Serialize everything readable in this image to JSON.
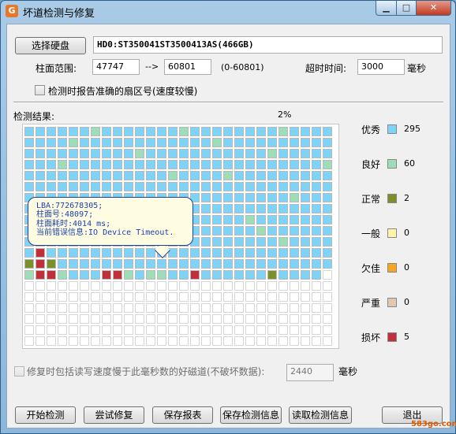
{
  "window": {
    "title": "坏道检测与修复",
    "app_icon_glyph": "G",
    "min_glyph": "▁",
    "max_glyph": "□",
    "close_glyph": "✕"
  },
  "disk": {
    "select_button": "选择硬盘",
    "disk_name": "HD0:ST350041ST3500413AS(466GB)"
  },
  "range": {
    "label": "柱面范围:",
    "start": "47747",
    "arrow": "-->",
    "end": "60801",
    "bounds": "(0-60801)"
  },
  "timeout": {
    "label": "超时时间:",
    "value": "3000",
    "unit": "毫秒"
  },
  "report_sector_checkbox": {
    "label": "检测时报告准确的扇区号(速度较慢)",
    "checked": false
  },
  "result": {
    "label": "检测结果:",
    "progress": "2%"
  },
  "tooltip": {
    "lba": "LBA:772678305;",
    "cylinder": "柱面号:48097;",
    "time": "柱面耗时:4014 ms;",
    "error": "当前错误信息:IO Device Timeout."
  },
  "grid": {
    "columns": 28,
    "rows": 20,
    "cell_states": [
      "AAAAAAGAAAAAAAGAAAAAAAAGAAAA",
      "AAAAGAAAAAAAAAAAAGAAAAAAAAAA",
      "AAAAAAAAAAGAAAAAAAAAAAGAAAAA",
      "AAAGAAAAAAAAAAAAAAAAAAAAAAAG",
      "AAAAAAAAAAAAAGAAAAGAAAAAAAAA",
      "AAAAAAAAAAAAAAAAAAAAAAAAAAAA",
      "AAAAAAAAAAAAAAAAAAAAAAAAGAAA",
      "AAAAAAAAAAAAAAAAAAAAAAAAAAAA",
      "AAAAAAAAAAAAAAAAAAAAGAAAAAAA",
      "AAAAAAAAAAAAAAAAAAAAAGAAAAAA",
      "AAAAAAAAAAAAAAAAAAAAAAAGAAAA",
      "ABAAAAAAAAAAAAAAAAAAAAAAAAAA",
      "ZBNAAAAAAAAAAAAAAAAAAAAAAAAA",
      "GBBGAAABBGAGGAABAAAAAANAAAAU",
      "UUUUUUUUUUUUUUUUUUUUUUUUUUUU",
      "UUUUUUUUUUUUUUUUUUUUUUUUUUUU",
      "UUUUUUUUUUUUUUUUUUUUUUUUUUUU",
      "UUUUUUUUUUUUUUUUUUUUUUUUUUUU",
      "UUUUUUUUUUUUUUUUUUUUUUUUUUUU",
      "UUUUUUUUUUUUUUUUUUUUUUUUUUUU"
    ]
  },
  "legend": [
    {
      "label": "优秀",
      "color": "#7fd3f7",
      "count": "295"
    },
    {
      "label": "良好",
      "color": "#9fdcb8",
      "count": "60"
    },
    {
      "label": "正常",
      "color": "#7b8f2a",
      "count": "2"
    },
    {
      "label": "一般",
      "color": "#fff3a8",
      "count": "0"
    },
    {
      "label": "欠佳",
      "color": "#f5a623",
      "count": "0"
    },
    {
      "label": "严重",
      "color": "#e0c8b4",
      "count": "0"
    },
    {
      "label": "损坏",
      "color": "#c0303a",
      "count": "5"
    }
  ],
  "repair_option": {
    "label": "修复时包括读写速度慢于此毫秒数的好磁道(不破坏数据):",
    "value": "2440",
    "unit": "毫秒",
    "checked": false
  },
  "buttons": {
    "start": "开始检测",
    "try_repair": "尝试修复",
    "save_report": "保存报表",
    "save_info": "保存检测信息",
    "read_info": "读取检测信息",
    "exit": "退出"
  },
  "watermark": "583go.com"
}
